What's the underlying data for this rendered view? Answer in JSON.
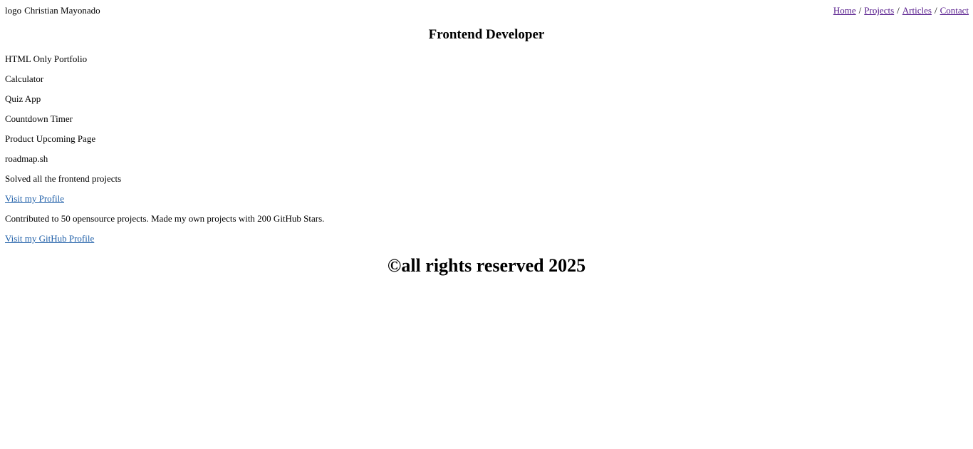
{
  "header": {
    "logo": "logo",
    "name": "Christian Mayonado",
    "nav": {
      "home": "Home",
      "projects": "Projects",
      "articles": "Articles",
      "contact": "Contact",
      "separator": "/"
    }
  },
  "hero": {
    "title": "Frontend Developer"
  },
  "projects": {
    "heading": "HTML Only Portfolio",
    "items": [
      "Calculator",
      "Quiz App",
      "Countdown Timer",
      "Product Upcoming Page"
    ]
  },
  "roadmap": {
    "title": "roadmap.sh",
    "description": "Solved all the frontend projects",
    "link": "Visit my Profile"
  },
  "github": {
    "description": "Contributed to 50 opensource projects. Made my own projects with 200 GitHub Stars.",
    "link": "Visit my GitHub Profile"
  },
  "footer": {
    "text": "©all rights reserved 2025"
  },
  "colors": {
    "visited_link": "#551a8b",
    "link": "#1f5fa8",
    "text": "#000000",
    "background": "#ffffff"
  }
}
